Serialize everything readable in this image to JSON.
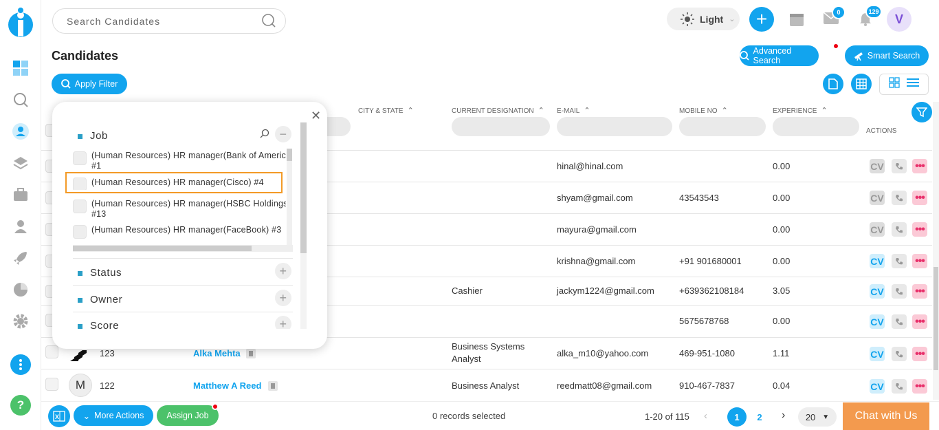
{
  "header": {
    "search_placeholder": "Search Candidates",
    "theme_label": "Light",
    "mail_count": "0",
    "notification_count": "129",
    "avatar_initial": "V"
  },
  "page": {
    "title": "Candidates",
    "advanced_search": "Advanced Search",
    "smart_search": "Smart Search",
    "apply_filter": "Apply Filter"
  },
  "table": {
    "columns": {
      "city_state": "CITY & STATE",
      "designation": "CURRENT DESIGNATION",
      "email": "E-MAIL",
      "mobile": "MOBILE NO",
      "experience": "EXPERIENCE",
      "actions": "ACTIONS"
    },
    "rows": [
      {
        "id": "",
        "name": "",
        "designation": "",
        "email": "hinal@hinal.com",
        "mobile": "",
        "experience": "0.00",
        "cv": "CV"
      },
      {
        "id": "",
        "name": "",
        "designation": "",
        "email": "shyam@gmail.com",
        "mobile": "43543543",
        "experience": "0.00",
        "cv": "CV"
      },
      {
        "id": "",
        "name": "",
        "designation": "",
        "email": "mayura@gmail.com",
        "mobile": "",
        "experience": "0.00",
        "cv": "CV"
      },
      {
        "id": "",
        "name": "",
        "designation": "",
        "email": "krishna@gmail.com",
        "mobile": "+91 901680001",
        "experience": "0.00",
        "cv": "CV"
      },
      {
        "id": "",
        "name": "",
        "designation": "Cashier",
        "email": "jackym1224@gmail.com",
        "mobile": "+639362108184",
        "experience": "3.05",
        "cv": "CV"
      },
      {
        "id": "",
        "name": "",
        "designation": "",
        "email": "",
        "mobile": "5675678768",
        "experience": "0.00",
        "cv": "CV"
      },
      {
        "id": "123",
        "name": "Alka Mehta",
        "designation": "Business Systems Analyst",
        "email": "alka_m10@yahoo.com",
        "mobile": "469-951-1080",
        "experience": "1.11",
        "cv": "CV"
      },
      {
        "id": "122",
        "name": "Matthew A Reed",
        "designation": "Business Analyst",
        "email": "reedmatt08@gmail.com",
        "mobile": "910-467-7837",
        "experience": "0.04",
        "cv": "CV",
        "avatar": "M"
      }
    ]
  },
  "filter_popup": {
    "job_section": "Job",
    "status_section": "Status",
    "owner_section": "Owner",
    "score_section": "Score",
    "jobs": [
      {
        "line1": "(Human Resources) HR manager(Bank of America)",
        "line2": "#1"
      },
      {
        "line1": "(Human Resources) HR manager(Cisco) #4",
        "line2": ""
      },
      {
        "line1": "(Human Resources) HR manager(HSBC Holdings)",
        "line2": "#13"
      },
      {
        "line1": "(Human Resources) HR manager(FaceBook) #3",
        "line2": ""
      }
    ]
  },
  "footer": {
    "more_actions": "More Actions",
    "assign_job": "Assign Job",
    "records_selected": "0 records selected",
    "range": "1-20 of 115",
    "page1": "1",
    "page2": "2",
    "page_size": "20",
    "chat": "Chat with Us"
  }
}
